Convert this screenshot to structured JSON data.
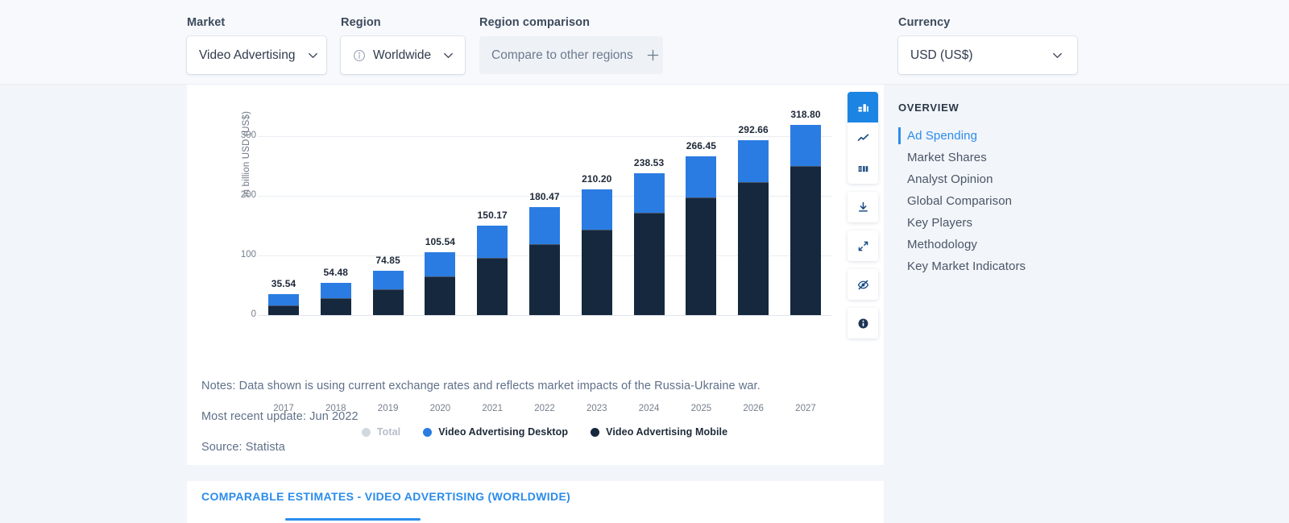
{
  "filters": {
    "market": {
      "label": "Market",
      "value": "Video Advertising",
      "icon": "chevron-down-icon"
    },
    "region": {
      "label": "Region",
      "value": "Worldwide",
      "info_icon": "info-circle-icon",
      "icon": "chevron-down-icon"
    },
    "region_comparison": {
      "label": "Region comparison",
      "value": "Compare to other regions",
      "icon": "plus-icon"
    },
    "currency": {
      "label": "Currency",
      "value": "USD (US$)",
      "icon": "chevron-down-icon"
    }
  },
  "chart_data": {
    "type": "bar",
    "stacked": true,
    "title": "",
    "xlabel": "",
    "ylabel": "in billion USD (US$)",
    "ylim": [
      0,
      300
    ],
    "yticks": [
      0,
      100,
      200,
      300
    ],
    "grid": true,
    "legend_position": "bottom",
    "categories": [
      "2017",
      "2018",
      "2019",
      "2020",
      "2021",
      "2022",
      "2023",
      "2024",
      "2025",
      "2026",
      "2027"
    ],
    "totals": [
      35.54,
      54.48,
      74.85,
      105.54,
      150.17,
      180.47,
      210.2,
      238.53,
      266.45,
      292.66,
      318.8
    ],
    "series": [
      {
        "name": "Video Advertising Mobile",
        "color": "#16283e",
        "values": [
          16.8,
          28.4,
          43.6,
          65.0,
          95.6,
          119.0,
          143.5,
          171.5,
          197.6,
          223.0,
          249.6
        ]
      },
      {
        "name": "Video Advertising Desktop",
        "color": "#2b7ce2",
        "values": [
          18.74,
          26.08,
          31.25,
          40.54,
          54.57,
          61.47,
          66.7,
          67.03,
          68.85,
          69.66,
          69.2
        ]
      }
    ],
    "legend": [
      {
        "label": "Total",
        "color": "#d3d8de",
        "enabled": false
      },
      {
        "label": "Video Advertising Desktop",
        "color": "#2b7ce2",
        "enabled": true
      },
      {
        "label": "Video Advertising Mobile",
        "color": "#16283e",
        "enabled": true
      }
    ]
  },
  "toolbar": {
    "items": [
      {
        "name": "bar-chart-icon",
        "active": true
      },
      {
        "name": "line-chart-icon",
        "active": false
      },
      {
        "name": "table-icon",
        "active": false
      },
      {
        "name": "download-icon",
        "active": false
      },
      {
        "name": "expand-icon",
        "active": false
      },
      {
        "name": "eye-off-icon",
        "active": false
      },
      {
        "name": "info-icon",
        "active": false
      }
    ]
  },
  "notes": {
    "line1": "Notes: Data shown is using current exchange rates and reflects market impacts of the Russia-Ukraine war.",
    "line2": "Most recent update: Jun 2022",
    "line3": "Source: Statista"
  },
  "sidebar": {
    "title": "OVERVIEW",
    "items": [
      {
        "label": "Ad Spending",
        "active": true
      },
      {
        "label": "Market Shares",
        "active": false
      },
      {
        "label": "Analyst Opinion",
        "active": false
      },
      {
        "label": "Global Comparison",
        "active": false
      },
      {
        "label": "Key Players",
        "active": false
      },
      {
        "label": "Methodology",
        "active": false
      },
      {
        "label": "Key Market Indicators",
        "active": false
      }
    ]
  },
  "bottom_card": {
    "title": "COMPARABLE ESTIMATES - VIDEO ADVERTISING (WORLDWIDE)"
  },
  "colors": {
    "accent": "#2b8ceb",
    "desktop": "#2b7ce2",
    "mobile": "#16283e",
    "page_bg": "#f2f5f9"
  }
}
